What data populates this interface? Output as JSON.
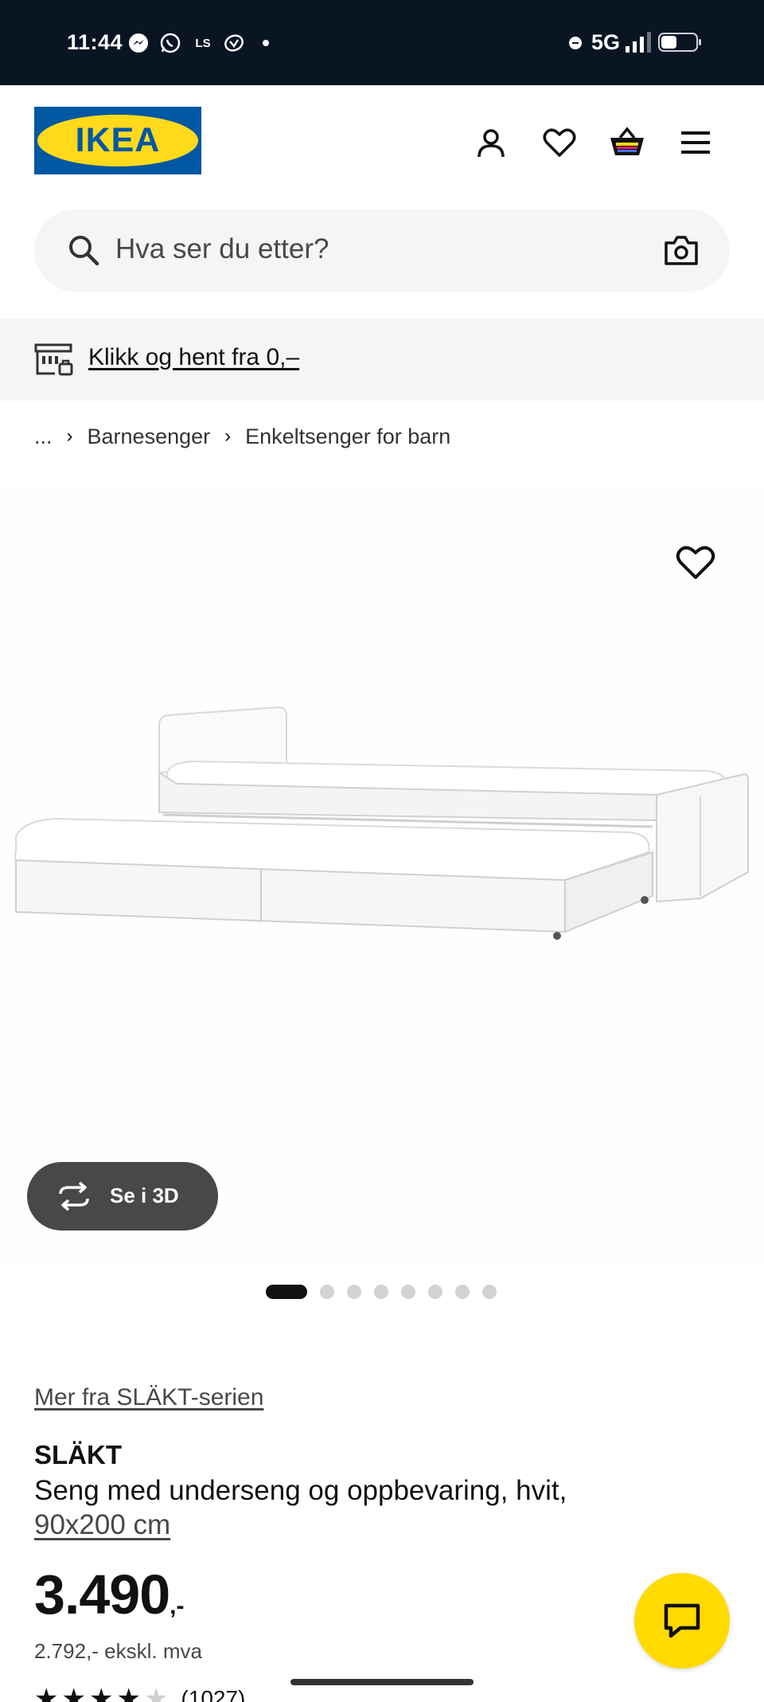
{
  "status_bar": {
    "time": "11:44",
    "network": "5G",
    "battery_level": 0.45,
    "icons": [
      "messenger-icon",
      "whatsapp-icon",
      "ls-icon",
      "gesture-icon"
    ]
  },
  "header": {
    "logo_text": "IKEA",
    "icons": [
      "profile-icon",
      "favourites-heart-icon",
      "basket-icon",
      "menu-icon"
    ]
  },
  "search": {
    "placeholder": "Hva ser du etter?"
  },
  "banner": {
    "link_text": "Klikk og hent fra 0,–"
  },
  "breadcrumb": {
    "items": [
      "...",
      "Barnesenger",
      "Enkeltsenger for barn"
    ]
  },
  "gallery": {
    "view_3d_label": "Se i 3D",
    "slide_count": 8,
    "active_slide": 1
  },
  "product": {
    "series_link": "Mer fra SLÄKT-serien",
    "name": "SLÄKT",
    "description": "Seng med underseng og oppbevaring, hvit,",
    "size": "90x200 cm",
    "price": "3.490",
    "price_suffix": ",-",
    "price_ex_vat": "2.792,- ekskl. mva",
    "rating": 4,
    "rating_max": 5,
    "review_count": "(1027)"
  },
  "colors": {
    "ikea_blue": "#0058a3",
    "ikea_yellow": "#ffda1a",
    "status_bar_bg": "#0a1524",
    "chat_button": "#ffdb00"
  }
}
